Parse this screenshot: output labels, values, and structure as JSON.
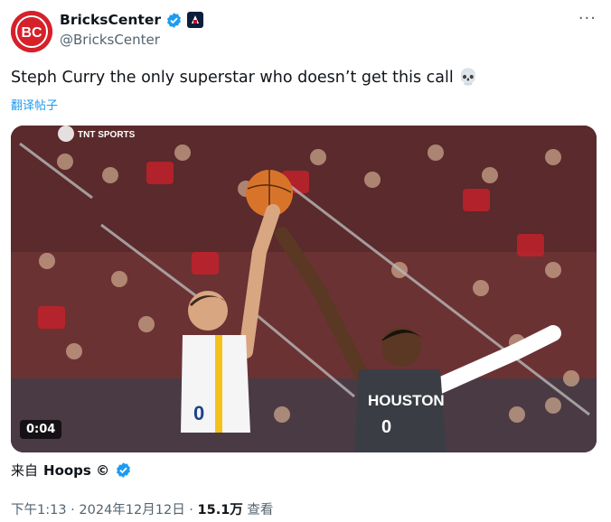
{
  "author": {
    "display_name": "BricksCenter",
    "handle": "@BricksCenter",
    "avatar_icon": "bc-logo",
    "avatar_text": "BC",
    "verified_icon": "verified-badge-icon",
    "affiliate_icon": "team-affiliate-icon"
  },
  "more_menu": "···",
  "tweet_text": "Steph Curry the only superstar who doesn’t get this call 💀",
  "translate_label": "翻译帖子",
  "media": {
    "type": "video",
    "duration": "0:04",
    "watermark": "TNT SPORTS",
    "jersey_text": "HOUSTON",
    "jersey_number": "0",
    "curry_number": "0"
  },
  "source": {
    "prefix": "来自",
    "name": "Hoops ©"
  },
  "meta": {
    "time": "下午1:13",
    "sep1": " · ",
    "date": "2024年12月12日",
    "sep2": " · ",
    "views": "15.1万",
    "views_label": " 查看"
  },
  "colors": {
    "verified": "#1d9bf0",
    "link": "#1d9bf0",
    "avatar": "#d6202a",
    "secondary_text": "#536471"
  }
}
